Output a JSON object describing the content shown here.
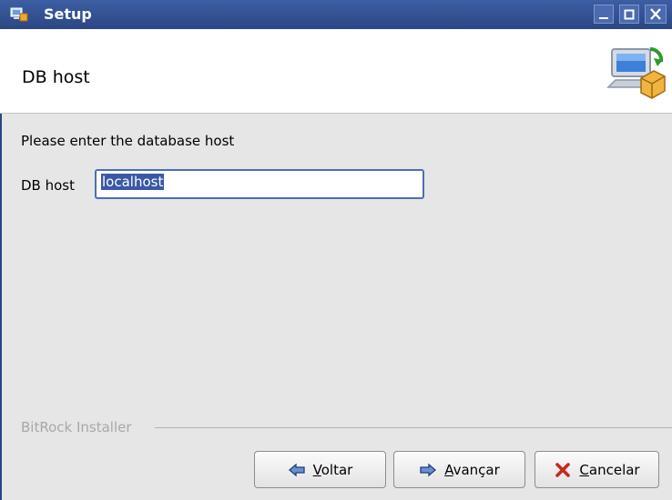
{
  "window": {
    "title": "Setup",
    "colors": {
      "titlebar": "#2c4684",
      "accent": "#3a58a5"
    }
  },
  "banner": {
    "title": "DB host",
    "icon": "computer-package-icon"
  },
  "form": {
    "prompt": "Please enter the database host",
    "host_label": "DB host",
    "host_value": "localhost"
  },
  "footer": {
    "group_label": "BitRock Installer",
    "buttons": {
      "back": {
        "mnemonic": "V",
        "rest": "oltar",
        "icon": "arrow-left-icon"
      },
      "next": {
        "mnemonic": "A",
        "rest": "vançar",
        "icon": "arrow-right-icon"
      },
      "cancel": {
        "mnemonic": "C",
        "rest": "ancelar",
        "icon": "close-icon"
      }
    }
  }
}
